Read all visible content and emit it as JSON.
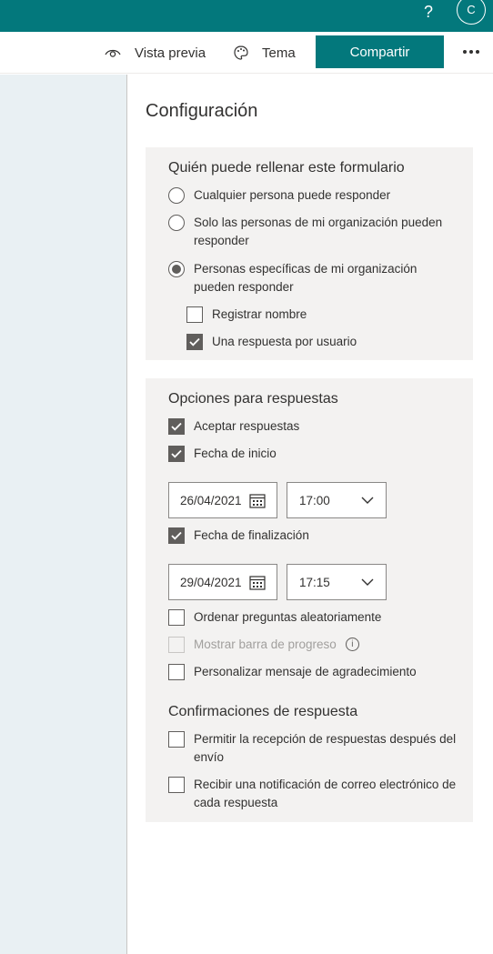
{
  "topbar": {
    "help": "?",
    "avatar": "C",
    "help_icon": "question-icon"
  },
  "cmdbar": {
    "preview_label": "Vista previa",
    "preview_icon": "eye-icon",
    "theme_label": "Tema",
    "theme_icon": "palette-icon",
    "share_label": "Compartir",
    "more_icon": "more-icon"
  },
  "panel": {
    "title": "Configuración"
  },
  "who": {
    "title": "Quién puede rellenar este formulario",
    "options": [
      {
        "label": "Cualquier persona puede responder",
        "checked": false
      },
      {
        "label": "Solo las personas de mi organización pueden responder",
        "checked": false
      },
      {
        "label": "Personas específicas de mi organización pueden responder",
        "checked": true
      }
    ],
    "sub": [
      {
        "label": "Registrar nombre",
        "checked": false
      },
      {
        "label": "Una respuesta por usuario",
        "checked": true
      }
    ]
  },
  "responses": {
    "title": "Opciones para respuestas",
    "accept": {
      "label": "Aceptar respuestas",
      "checked": true
    },
    "start": {
      "label": "Fecha de inicio",
      "checked": true,
      "date": "26/04/2021",
      "time": "17:00"
    },
    "end": {
      "label": "Fecha de finalización",
      "checked": true,
      "date": "29/04/2021",
      "time": "17:15"
    },
    "shuffle": {
      "label": "Ordenar preguntas aleatoriamente",
      "checked": false
    },
    "progress": {
      "label": "Mostrar barra de progreso",
      "checked": false,
      "disabled": true
    },
    "thanks": {
      "label": "Personalizar mensaje de agradecimiento",
      "checked": false
    }
  },
  "confirm": {
    "title": "Confirmaciones de respuesta",
    "receipt": {
      "label": "Permitir la recepción de respuestas después del envío",
      "checked": false
    },
    "notify": {
      "label": "Recibir una notificación de correo electrónico de cada respuesta",
      "checked": false
    }
  },
  "colors": {
    "brand": "#03787c",
    "panel_bg": "#f3f2f1",
    "left_bg": "#e9f0f3",
    "check": "#605e5c"
  }
}
